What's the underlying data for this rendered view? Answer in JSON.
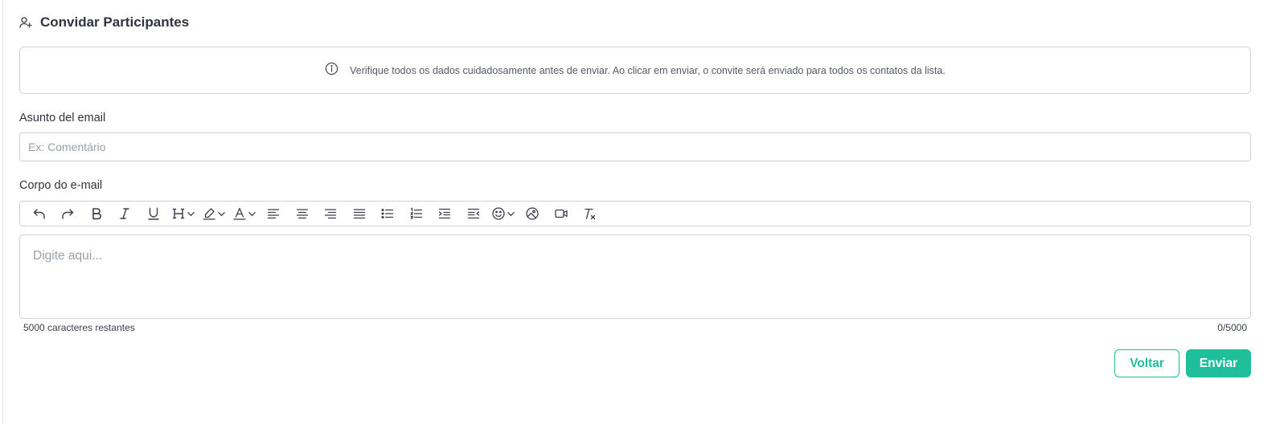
{
  "header": {
    "title": "Convidar Participantes",
    "icon": "user-plus-icon"
  },
  "info": {
    "icon": "info-icon",
    "text": "Verifique todos os dados cuidadosamente antes de enviar. Ao clicar em enviar, o convite será enviado para todos os contatos da lista."
  },
  "subject": {
    "label": "Asunto del email",
    "placeholder": "Ex: Comentário",
    "value": ""
  },
  "body": {
    "label": "Corpo do e-mail",
    "placeholder": "Digite aqui...",
    "remaining": "5000 caracteres restantes",
    "count": "0/5000"
  },
  "toolbar": [
    "undo-icon",
    "redo-icon",
    "bold-icon",
    "italic-icon",
    "underline-icon",
    "heading-dropdown",
    "highlight-dropdown",
    "font-color-dropdown",
    "align-left-icon",
    "align-center-icon",
    "align-right-icon",
    "align-justify-icon",
    "bullet-list-icon",
    "numbered-list-icon",
    "indent-icon",
    "outdent-icon",
    "emoji-dropdown",
    "image-icon",
    "video-icon",
    "clear-format-icon"
  ],
  "actions": {
    "back_label": "Voltar",
    "send_label": "Enviar"
  },
  "colors": {
    "accent": "#1fbf9c",
    "border": "#cfd3d8"
  }
}
